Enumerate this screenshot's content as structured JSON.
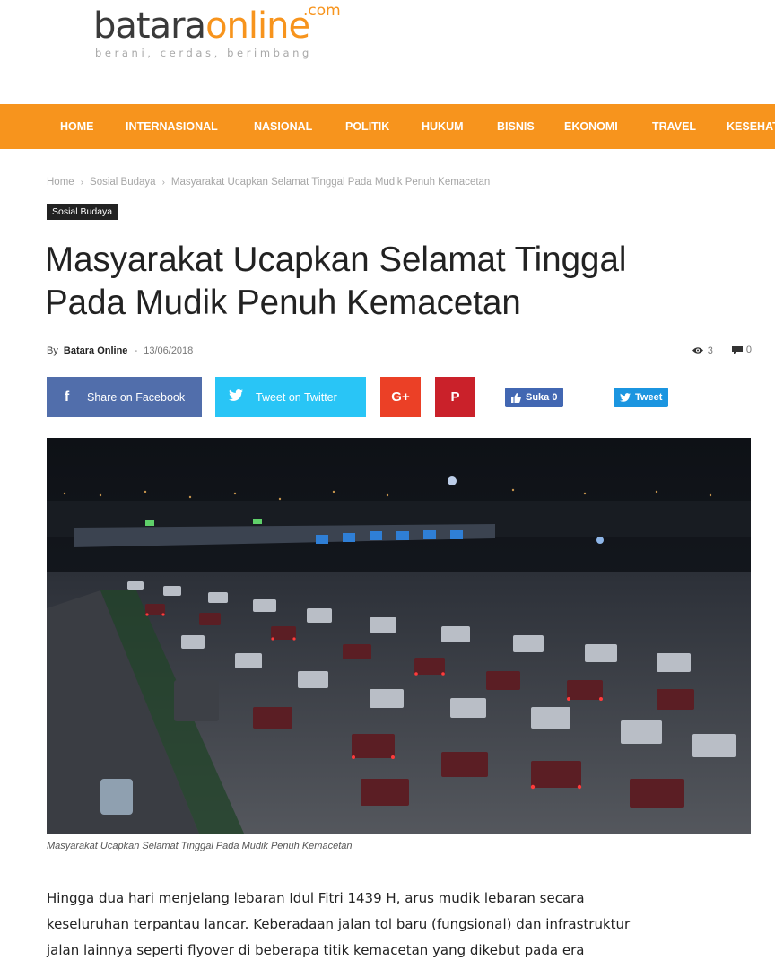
{
  "site": {
    "logo_part1": "batara",
    "logo_part2": "online",
    "logo_com": ".com",
    "tagline": "berani, cerdas, berimbang"
  },
  "nav": {
    "items": [
      "HOME",
      "INTERNASIONAL",
      "NASIONAL",
      "POLITIK",
      "HUKUM",
      "BISNIS",
      "EKONOMI",
      "TRAVEL",
      "KESEHAT"
    ]
  },
  "breadcrumb": {
    "home": "Home",
    "category": "Sosial Budaya",
    "current": "Masyarakat Ucapkan Selamat Tinggal Pada Mudik Penuh Kemacetan"
  },
  "article": {
    "category_badge": "Sosial Budaya",
    "title_line1": "Masyarakat Ucapkan Selamat Tinggal",
    "title_line2": "Pada Mudik Penuh Kemacetan",
    "by_label": "By",
    "author": "Batara Online",
    "dash": "-",
    "date": "13/06/2018",
    "views": "3",
    "comments": "0",
    "caption": "Masyarakat Ucapkan Selamat Tinggal Pada Mudik Penuh Kemacetan",
    "body_lines": [
      "Hingga dua hari menjelang lebaran Idul Fitri 1439 H, arus mudik lebaran secara",
      "keseluruhan terpantau lancar. Keberadaan jalan tol baru (fungsional) dan infrastruktur",
      "jalan lainnya seperti flyover di beberapa titik kemacetan yang dikebut pada era"
    ]
  },
  "share": {
    "facebook": "Share on Facebook",
    "twitter": "Tweet on Twitter",
    "googleplus": "G+",
    "pinterest": "P",
    "like_label": "Suka 0",
    "tweet_label": "Tweet"
  },
  "colors": {
    "brand_orange": "#f7941d",
    "facebook": "#516eab",
    "twitter": "#29c5f6",
    "googleplus": "#eb4026",
    "pinterest": "#ca212a"
  }
}
